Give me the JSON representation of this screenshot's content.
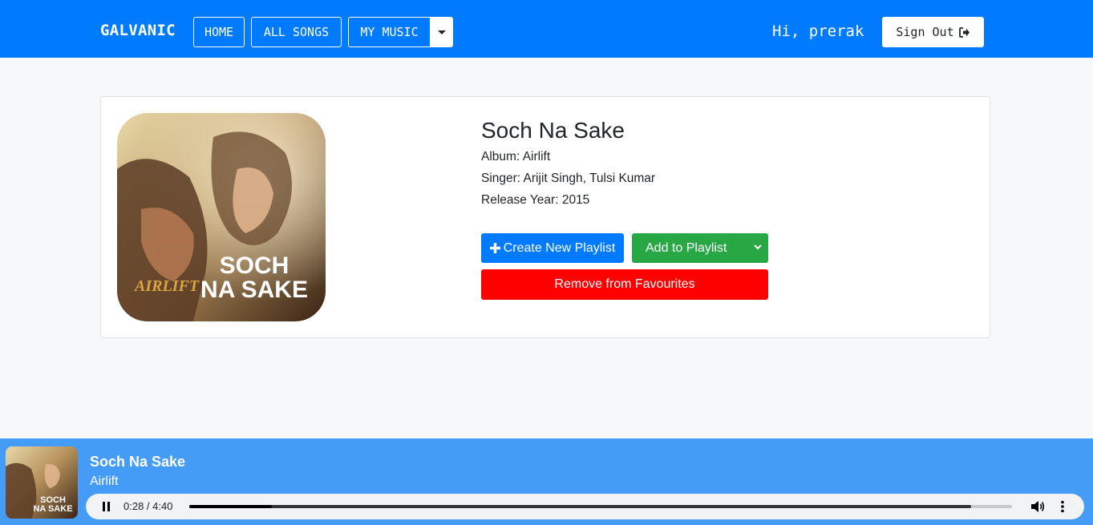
{
  "nav": {
    "brand": "GALVANIC",
    "home": "HOME",
    "all_songs": "ALL SONGS",
    "my_music": "MY MUSIC",
    "greeting": "Hi, prerak",
    "sign_out": "Sign Out"
  },
  "song": {
    "title": "Soch Na Sake",
    "album_line": "Album: Airlift",
    "singer_line": "Singer: Arijit Singh, Tulsi Kumar",
    "year_line": "Release Year: 2015",
    "cover_text_line1": "SOCH",
    "cover_text_line2": "NA SAKE",
    "cover_logo": "AIRLIFT"
  },
  "actions": {
    "create_playlist": "Create New Playlist",
    "add_to_playlist": "Add to Playlist",
    "remove_favourites": "Remove from Favourites"
  },
  "player": {
    "title": "Soch Na Sake",
    "album": "Airlift",
    "time": "0:28 / 4:40",
    "played_fraction": 0.1,
    "buffered_fraction": 0.95
  },
  "colors": {
    "navbar": "#007bff",
    "create_btn": "#007bff",
    "add_btn": "#28a745",
    "remove_btn": "#ff0000",
    "player_bg": "#459cf7"
  },
  "icons": {
    "create": "plus-icon",
    "signout": "sign-out-icon",
    "caret": "caret-down-icon",
    "pause": "pause-icon",
    "volume": "volume-icon",
    "more": "more-vertical-icon"
  }
}
